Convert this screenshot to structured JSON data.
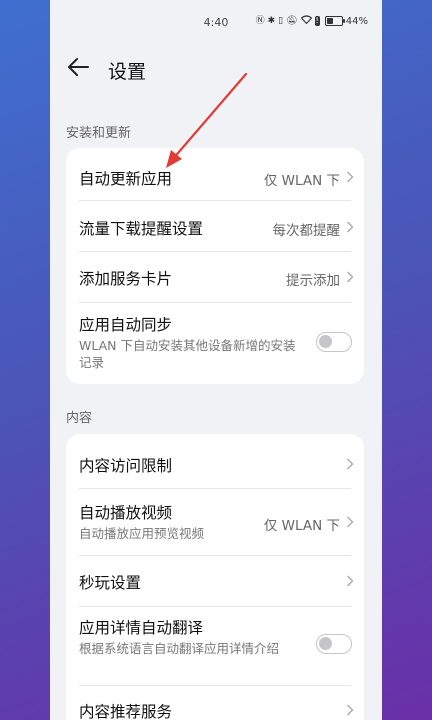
{
  "status": {
    "time": "4:40",
    "icons": [
      "nfc-icon",
      "bluetooth-icon",
      "vibrate-icon",
      "mute-icon",
      "wifi-icon",
      "notification-icon"
    ],
    "battery": "44%",
    "battery_level": 0.44
  },
  "header": {
    "title": "设置",
    "back_icon": "back-arrow-icon"
  },
  "sections": [
    {
      "label": "安装和更新",
      "rows": [
        {
          "label": "自动更新应用",
          "value": "仅 WLAN 下"
        },
        {
          "label": "流量下载提醒设置",
          "value": "每次都提醒"
        },
        {
          "label": "添加服务卡片",
          "value": "提示添加"
        },
        {
          "label": "应用自动同步",
          "sub": "WLAN 下自动安装其他设备新增的安装记录",
          "toggle": false
        }
      ]
    },
    {
      "label": "内容",
      "rows": [
        {
          "label": "内容访问限制"
        },
        {
          "label": "自动播放视频",
          "sub": "自动播放应用预览视频",
          "value": "仅 WLAN 下"
        },
        {
          "label": "秒玩设置"
        },
        {
          "label": "应用详情自动翻译",
          "sub": "根据系统语言自动翻译应用详情介绍",
          "toggle": false
        },
        {
          "label": "内容推荐服务"
        }
      ]
    }
  ],
  "annotation": {
    "color": "#e53935"
  }
}
